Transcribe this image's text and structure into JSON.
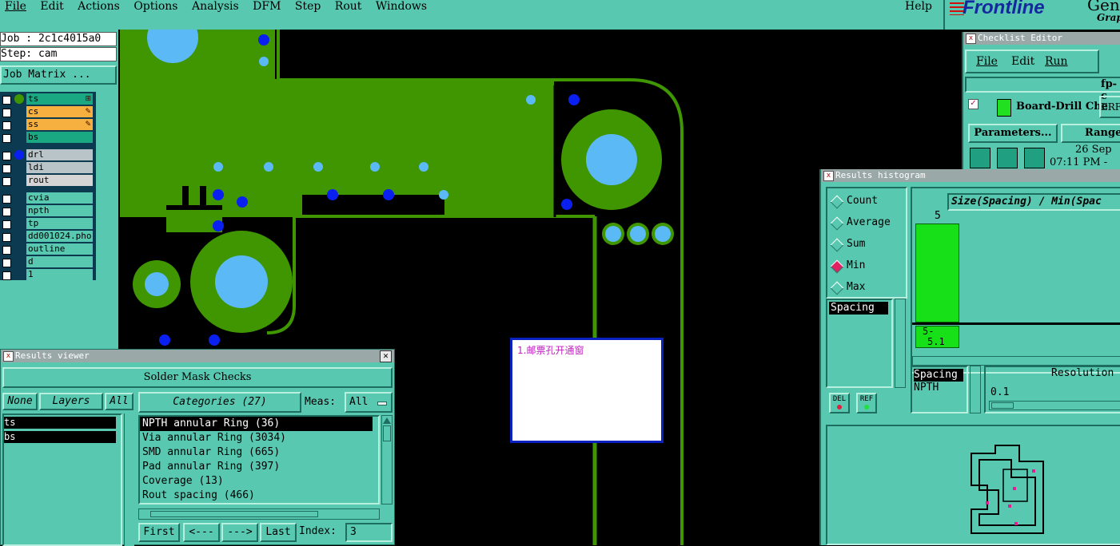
{
  "menu": {
    "items": [
      "File",
      "Edit",
      "Actions",
      "Options",
      "Analysis",
      "DFM",
      "Step",
      "Rout",
      "Windows"
    ],
    "help": "Help"
  },
  "brand": {
    "logo": "Frontline",
    "genesis_partial": "Gene",
    "graphic_partial": "Grap"
  },
  "job": {
    "job_line": "Job : 2c1c4015a0",
    "step_line": "Step: cam",
    "matrix_button": "Job Matrix ..."
  },
  "layers": [
    {
      "name": "ts",
      "color": "#1aa882",
      "icon": "grid-icon"
    },
    {
      "name": "cs",
      "color": "#f6b040",
      "icon": "edit-icon"
    },
    {
      "name": "ss",
      "color": "#f6b040",
      "icon": "edit-icon"
    },
    {
      "name": "bs",
      "color": "#1aa882",
      "icon": ""
    },
    {
      "name": "drl",
      "color": "#b8c4c8",
      "icon": ""
    },
    {
      "name": "ldi",
      "color": "#b8c4c8",
      "icon": ""
    },
    {
      "name": "rout",
      "color": "#d4d4d4",
      "icon": ""
    },
    {
      "name": "cvia",
      "color": "#58c8b0",
      "icon": ""
    },
    {
      "name": "npth",
      "color": "#58c8b0",
      "icon": ""
    },
    {
      "name": "tp",
      "color": "#58c8b0",
      "icon": ""
    },
    {
      "name": "dd001024.pho",
      "color": "#58c8b0",
      "icon": ""
    },
    {
      "name": "outline",
      "color": "#58c8b0",
      "icon": ""
    },
    {
      "name": "d",
      "color": "#58c8b0",
      "icon": ""
    },
    {
      "name": "1",
      "color": "#58c8b0",
      "icon": ""
    }
  ],
  "note": {
    "text": "1.邮票孔开通窗"
  },
  "results_viewer": {
    "title": "Results viewer",
    "header": "Solder Mask Checks",
    "buttons": {
      "none": "None",
      "layers": "Layers",
      "all": "All"
    },
    "layer_list": [
      "ts",
      "bs"
    ],
    "categories_label": "Categories (27)",
    "meas_label": "Meas:",
    "meas_value": "All",
    "categories": [
      "NPTH annular Ring (36)",
      "Via annular Ring (3034)",
      "SMD annular Ring (665)",
      "Pad annular Ring (397)",
      "Coverage (13)",
      "Rout spacing (466)"
    ],
    "nav": {
      "first": "First",
      "prev": "<---",
      "next": "--->",
      "last": "Last",
      "index_label": "Index:",
      "index_value": "3"
    }
  },
  "checklist": {
    "title": "Checklist Editor",
    "menu": [
      "File",
      "Edit",
      "Run"
    ],
    "name_partial": "fp-c",
    "action": "Board-Drill Che",
    "erf": "ERF",
    "params_button": "Parameters...",
    "ranges_button": "Ranges",
    "date": "26 Sep",
    "time": "07:11 PM -"
  },
  "histogram": {
    "title": "Results histogram",
    "modes": [
      "Count",
      "Average",
      "Sum",
      "Min",
      "Max"
    ],
    "selected_mode": "Min",
    "list": [
      "Spacing"
    ],
    "chart_title": "Size(Spacing) / Min(Spac",
    "bar_label": "5",
    "bin_label_top": "5-",
    "bin_label_bottom": "5.1",
    "del_label": "DEL",
    "ref_label": "REF",
    "selection": [
      "Spacing",
      "NPTH"
    ],
    "resolution_label": "Resolution",
    "resolution_value": "0.1"
  },
  "colors": {
    "panel": "#58c8b0",
    "copper": "#3f9600",
    "pad": "#5bbaf6",
    "via": "#0a20f0",
    "highlight": "#e02090"
  }
}
